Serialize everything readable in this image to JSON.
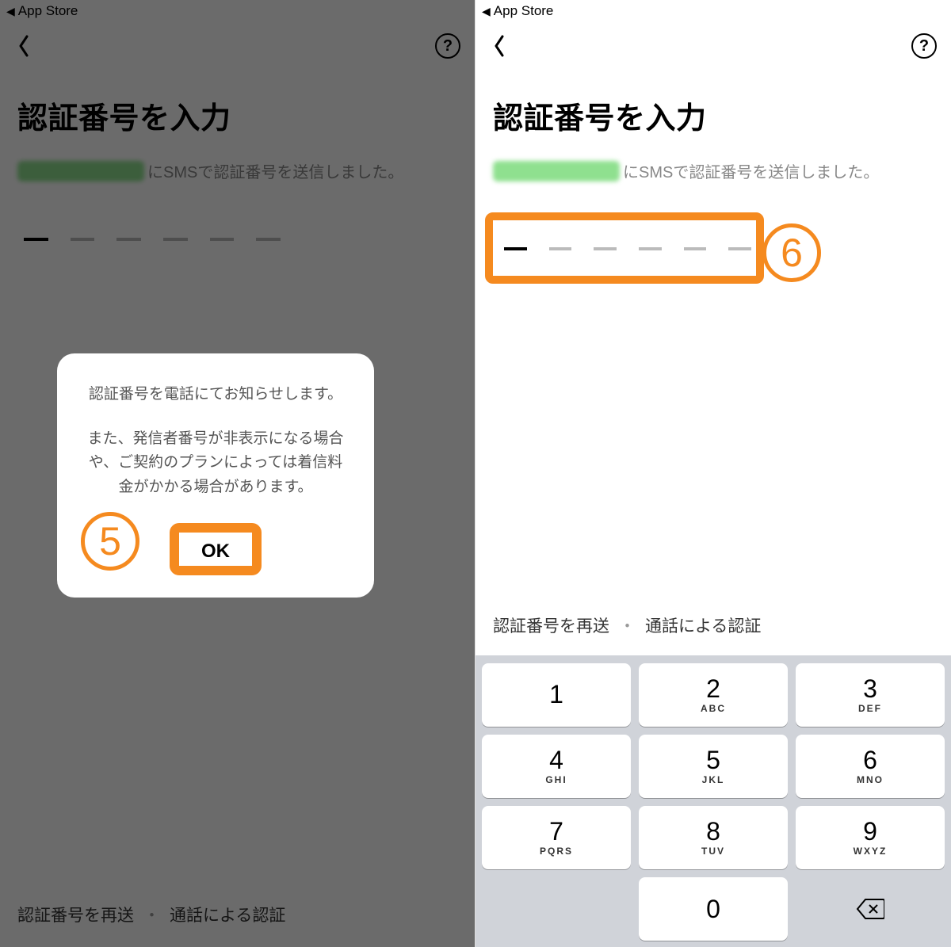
{
  "status_bar": {
    "back_label": "App Store"
  },
  "nav": {
    "help_glyph": "?"
  },
  "page": {
    "title": "認証番号を入力",
    "subtitle_suffix": "にSMSで認証番号を送信しました。"
  },
  "footer": {
    "resend_label": "認証番号を再送",
    "separator": "・",
    "call_auth_label": "通話による認証"
  },
  "dialog": {
    "line1": "認証番号を電話にてお知らせします。",
    "line2": "また、発信者番号が非表示になる場合や、ご契約のプランによっては着信料金がかかる場合があります。",
    "ok_label": "OK"
  },
  "annotations": {
    "step5": "5",
    "step6": "6"
  },
  "keypad": {
    "rows": [
      [
        {
          "num": "1",
          "sub": ""
        },
        {
          "num": "2",
          "sub": "ABC"
        },
        {
          "num": "3",
          "sub": "DEF"
        }
      ],
      [
        {
          "num": "4",
          "sub": "GHI"
        },
        {
          "num": "5",
          "sub": "JKL"
        },
        {
          "num": "6",
          "sub": "MNO"
        }
      ],
      [
        {
          "num": "7",
          "sub": "PQRS"
        },
        {
          "num": "8",
          "sub": "TUV"
        },
        {
          "num": "9",
          "sub": "WXYZ"
        }
      ]
    ],
    "zero": {
      "num": "0",
      "sub": ""
    }
  }
}
